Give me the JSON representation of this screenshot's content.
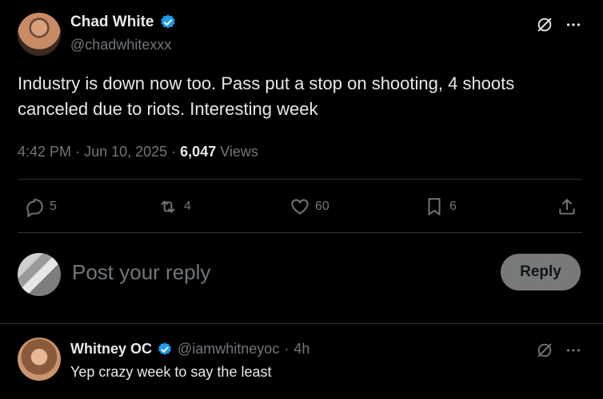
{
  "tweet": {
    "author_name": "Chad White",
    "author_handle": "@chadwhitexxx",
    "text": "Industry is down now too. Pass put a stop on shooting, 4 shoots canceled due to riots. Interesting week",
    "time": "4:42 PM",
    "date": "Jun 10, 2025",
    "views_count": "6,047",
    "views_label": "Views",
    "replies": "5",
    "reposts": "4",
    "likes": "60",
    "bookmarks": "6"
  },
  "composer": {
    "placeholder": "Post your reply",
    "reply_label": "Reply"
  },
  "reply": {
    "author_name": "Whitney OC",
    "author_handle": "@iamwhitneyoc",
    "age": "4h",
    "text": "Yep crazy week to say the least"
  },
  "colors": {
    "background": "#000000",
    "text": "#e7e9ea",
    "muted": "#71767b",
    "verified": "#1d9bf0",
    "divider": "#2f3336"
  },
  "icons": [
    "verified-badge-icon",
    "grok-icon",
    "more-icon",
    "reply-icon",
    "repost-icon",
    "like-icon",
    "bookmark-icon",
    "share-icon"
  ]
}
